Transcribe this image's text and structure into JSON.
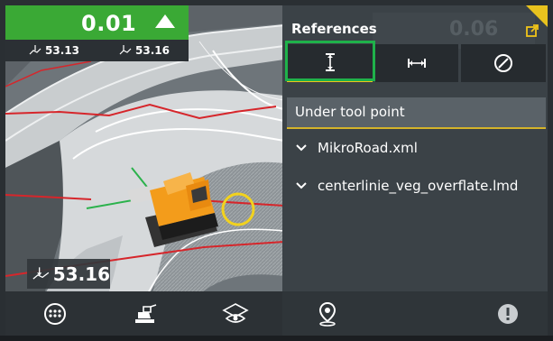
{
  "elevation": {
    "cut_fill": "0.01",
    "left_value": "53.13",
    "right_value": "53.16",
    "readout": "53.16",
    "accent": "#3aa935"
  },
  "toolbar": {
    "icons": [
      "keypad-icon",
      "machine-icon",
      "view-icon"
    ]
  },
  "panel": {
    "title": "References",
    "ghost_value": "0.06",
    "tabs": [
      {
        "name": "vertical",
        "icon": "vertical-distance-icon",
        "active": true
      },
      {
        "name": "horizontal",
        "icon": "horizontal-distance-icon",
        "active": false
      },
      {
        "name": "disabled",
        "icon": "disabled-icon",
        "active": false
      }
    ],
    "section": "Under tool point",
    "items": [
      {
        "label": "MikroRoad.xml"
      },
      {
        "label": "centerlinie_veg_overflate.lmd"
      }
    ],
    "footer_icons": [
      "location-pin-icon",
      "warning-icon"
    ]
  },
  "colors": {
    "highlight_green": "#1fb24a",
    "accent_yellow": "#f0c419"
  }
}
